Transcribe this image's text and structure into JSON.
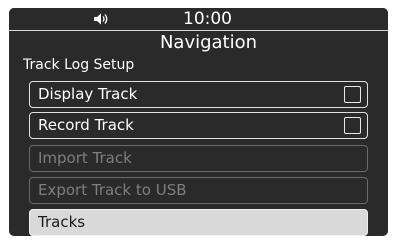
{
  "status_bar": {
    "volume_icon": "speaker-volume-icon",
    "time": "10:00"
  },
  "header": {
    "title": "Navigation"
  },
  "section": {
    "label": "Track Log Setup"
  },
  "menu": {
    "items": [
      {
        "label": "Display Track",
        "state": "enabled",
        "checkbox": true,
        "checked": false
      },
      {
        "label": "Record Track",
        "state": "enabled",
        "checkbox": true,
        "checked": false
      },
      {
        "label": "Import Track",
        "state": "disabled",
        "checkbox": false
      },
      {
        "label": "Export Track to USB",
        "state": "disabled",
        "checkbox": false
      },
      {
        "label": "Tracks",
        "state": "selected",
        "checkbox": false
      }
    ]
  },
  "colors": {
    "background": "#2a2a2a",
    "text": "#ffffff",
    "disabled_text": "#7e7e7e",
    "selected_background": "#d9d9d9"
  }
}
